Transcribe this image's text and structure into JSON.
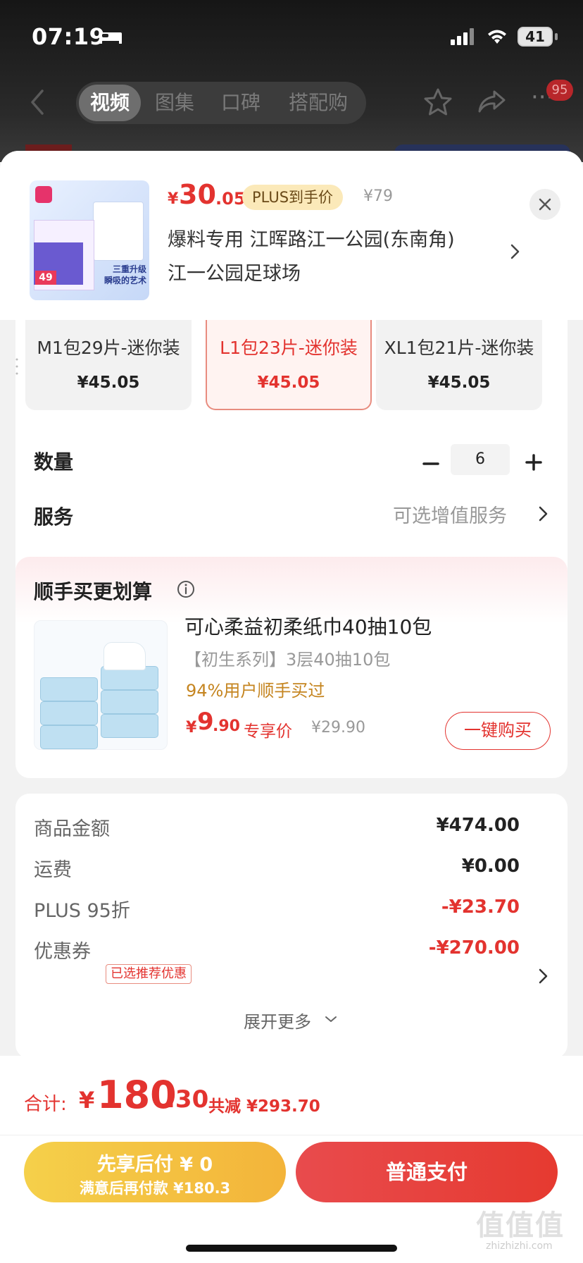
{
  "status_bar": {
    "time": "07:19",
    "battery": "41"
  },
  "nav": {
    "tabs": [
      {
        "label": "视频",
        "active": true
      },
      {
        "label": "图集",
        "active": false
      },
      {
        "label": "口碑",
        "active": false
      },
      {
        "label": "搭配购",
        "active": false
      }
    ],
    "badge_count": "95"
  },
  "product_header": {
    "price_currency": "¥",
    "price_int": "30",
    "price_dec": ".05",
    "plus_badge": "PLUS到手价",
    "original_price": "¥79",
    "address_line1": "爆料专用  江晖路江一公园(东南角)",
    "address_line2": "江一公园足球场",
    "thumbnail_slogan": "三重升级\n瞬吸的艺术",
    "thumbnail_tag": "49"
  },
  "sku_options": [
    {
      "name": "M1包29片-迷你装",
      "price": "¥45.05",
      "selected": false
    },
    {
      "name": "L1包23片-迷你装",
      "price": "¥45.05",
      "selected": true
    },
    {
      "name": "XL1包21片-迷你装",
      "price": "¥45.05",
      "selected": false
    }
  ],
  "quantity": {
    "label": "数量",
    "value": "6"
  },
  "service": {
    "label": "服务",
    "value": "可选增值服务"
  },
  "combo": {
    "title": "顺手买更划算",
    "product_name": "可心柔益初柔纸巾40抽10包",
    "product_sub": "【初生系列】3层40抽10包",
    "stat": "94%用户顺手买过",
    "price_currency": "¥",
    "price_int": "9",
    "price_dec": ".90",
    "price_label": "专享价",
    "original_price": "¥29.90",
    "buy_label": "一键购买"
  },
  "summary": {
    "rows": [
      {
        "label": "商品金额",
        "value": "¥474.00",
        "red": false
      },
      {
        "label": "运费",
        "value": "¥0.00",
        "red": false
      },
      {
        "label": "PLUS 95折",
        "value": "-¥23.70",
        "red": true
      },
      {
        "label": "优惠券",
        "value": "-¥270.00",
        "red": true
      }
    ],
    "coupon_tag": "已选推荐优惠",
    "expand_label": "展开更多"
  },
  "footer": {
    "total_label": "合计:",
    "total_currency": "¥",
    "total_int": "180",
    "total_dec": ".30",
    "total_saved": "共减 ¥293.70",
    "pay_later_line1": "先享后付 ¥ 0",
    "pay_later_line2": "满意后再付款 ¥180.3",
    "pay_label": "普通支付"
  },
  "watermark": {
    "logo_text": "值值值",
    "url": "zhizhizhi.com"
  },
  "colors": {
    "accent_red": "#e3332f",
    "plus_badge_bg": "#fbe9b9",
    "pay_later_yellow": "#f3b43a",
    "stat_orange": "#c58520"
  }
}
